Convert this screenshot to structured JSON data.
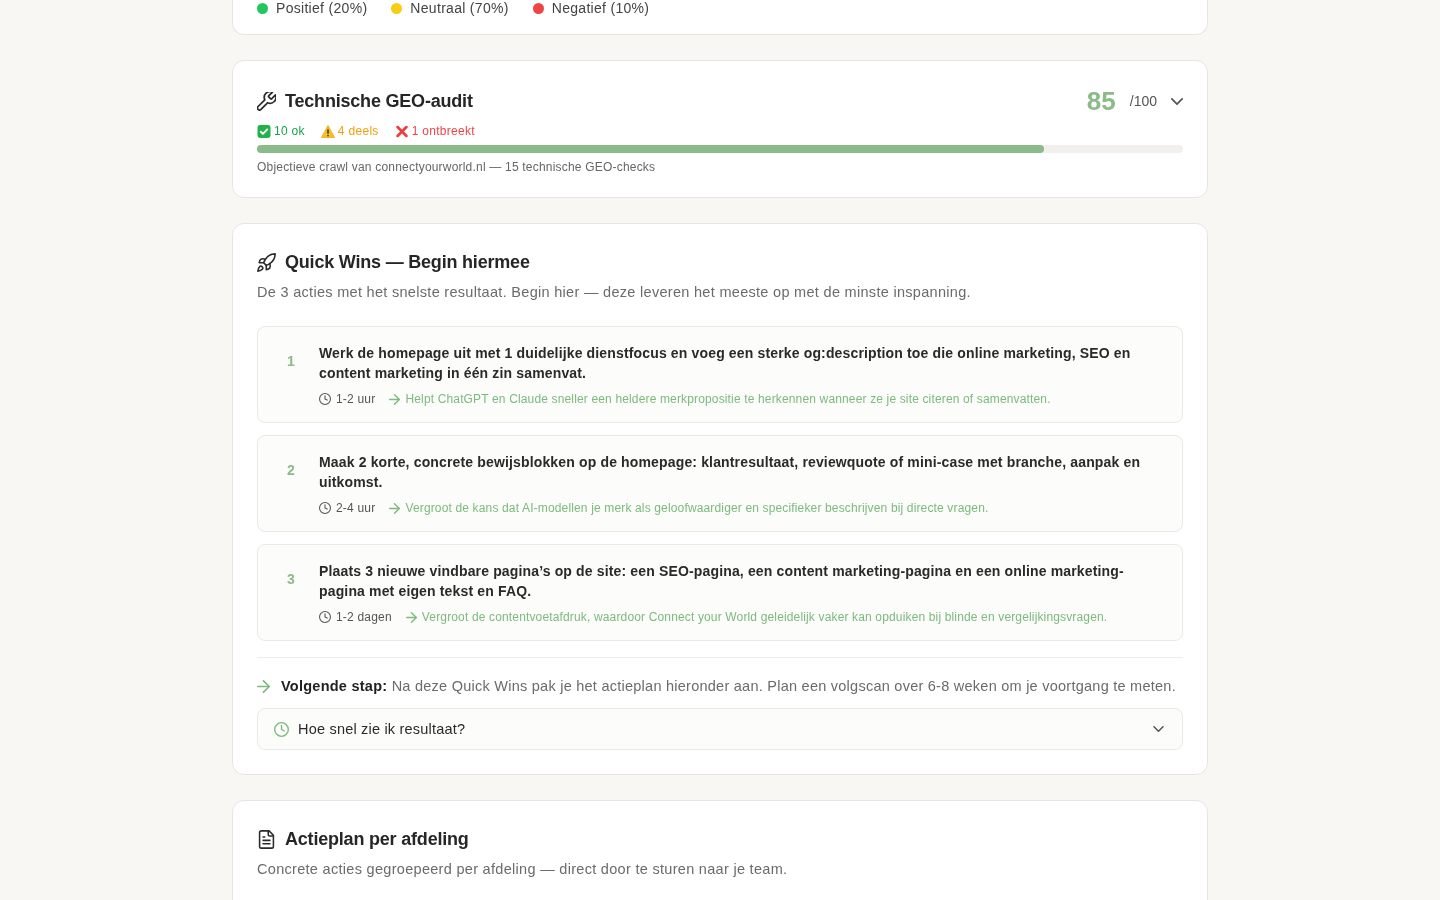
{
  "sentiment_legend": [
    {
      "label": "Positief (20%)",
      "color": "#22c55e"
    },
    {
      "label": "Neutraal (70%)",
      "color": "#facc15"
    },
    {
      "label": "Negatief (10%)",
      "color": "#ef4444"
    }
  ],
  "technical_audit": {
    "title": "Technische GEO-audit",
    "score": "85",
    "score_max": "/100",
    "status_counts": [
      {
        "kind": "ok",
        "label": "10 ok"
      },
      {
        "kind": "partial",
        "label": "4 deels"
      },
      {
        "kind": "missing",
        "label": "1 ontbreekt"
      }
    ],
    "progress": {
      "level": 0.85
    },
    "caption": "Objectieve crawl van connectyourworld.nl — 15 technische GEO-checks"
  },
  "quick_wins": {
    "title": "Quick Wins — Begin hiermee",
    "subtitle": "De 3 acties met het snelste resultaat. Begin hier — deze leveren het meeste op met de minste inspanning.",
    "items": [
      {
        "number": "1",
        "text": "Werk de homepage uit met 1 duidelijke dienstfocus en voeg een sterke og:description toe die online marketing, SEO en content marketing in één zin samenvat.",
        "time": "1-2 uur",
        "benefit": "Helpt ChatGPT en Claude sneller een heldere merkpropositie te herkennen wanneer ze je site citeren of samenvatten."
      },
      {
        "number": "2",
        "text": "Maak 2 korte, concrete bewijsblokken op de homepage: klantresultaat, reviewquote of mini-case met branche, aanpak en uitkomst.",
        "time": "2-4 uur",
        "benefit": "Vergroot de kans dat AI-modellen je merk als geloofwaardiger en specifieker beschrijven bij directe vragen."
      },
      {
        "number": "3",
        "text": "Plaats 3 nieuwe vindbare pagina’s op de site: een SEO-pagina, een content marketing-pagina en een online marketing-pagina met eigen tekst en FAQ.",
        "time": "1-2 dagen",
        "benefit": "Vergroot de contentvoetafdruk, waardoor Connect your World geleidelijk vaker kan opduiken bij blinde en vergelijkingsvragen."
      }
    ],
    "next_step": "**Volgende stap:** Na deze Quick Wins pak je het actieplan hieronder aan. Plan een volgscan over 6-8 weken om je voortgang te meten.",
    "faq": {
      "question": "Hoe snel zie ik resultaat?"
    }
  },
  "action_plan": {
    "title": "Actieplan per afdeling",
    "subtitle": "Concrete acties gegroepeerd per afdeling — direct door te sturen naar je team."
  }
}
